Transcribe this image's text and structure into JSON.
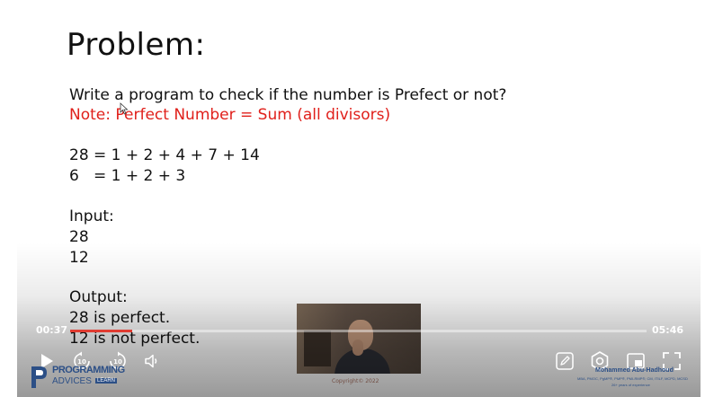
{
  "slide": {
    "title": "Problem:",
    "question": "Write a program to check if the number is Prefect or not?",
    "note": "Note: Perfect Number = Sum (all divisors)",
    "example1": "28 = 1 + 2 + 4 + 7 + 14",
    "example2": "6   = 1 + 2 + 3",
    "input_label": "Input:",
    "input_values": [
      "28",
      "12"
    ],
    "output_label": "Output:",
    "output_values": [
      "28 is perfect.",
      "12 is not perfect."
    ],
    "copyright": "Copyright© 2022"
  },
  "branding": {
    "logo_line1": "PROGRAMMING",
    "logo_line2": "ADVICES",
    "logo_badge": "LEARN",
    "author_name": "Mohammed Abu-Hadhoud",
    "author_creds": "MBA, PMOC, PgMP®, PMP®, PMI-RMP®, CM, ITILF, MCPD, MCSD",
    "author_sub": "26+ years of experience"
  },
  "player": {
    "current_time": "00:37",
    "total_time": "05:46",
    "progress": 0.107,
    "rewind_label": "10",
    "forward_label": "10",
    "accent_color": "#e03c31"
  },
  "icons": {
    "play": "play-icon",
    "rewind": "rewind-10-icon",
    "forward": "forward-10-icon",
    "volume": "volume-icon",
    "edit": "pencil-icon",
    "settings": "settings-hexagon-icon",
    "pip": "picture-in-picture-icon",
    "fullscreen": "fullscreen-icon"
  }
}
